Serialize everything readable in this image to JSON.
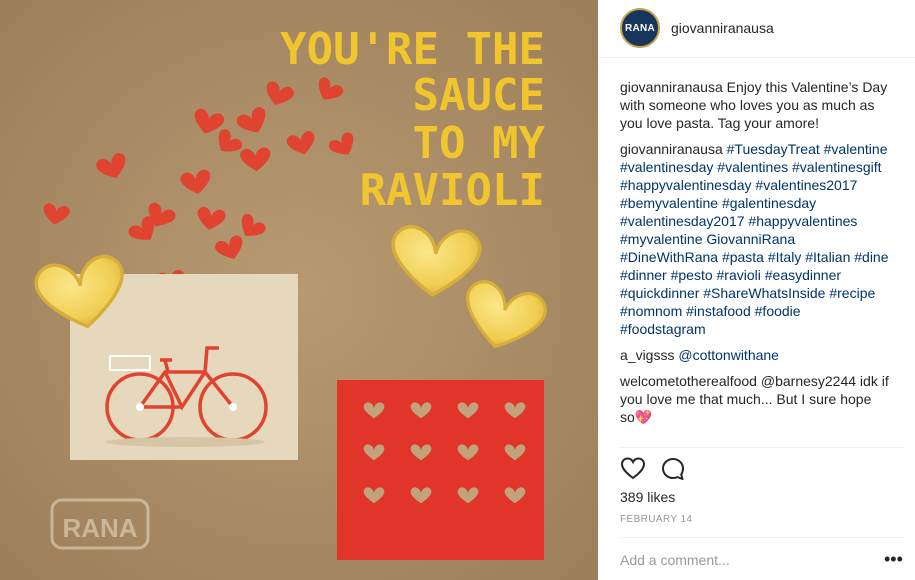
{
  "post": {
    "overlay_lines": [
      "YOU'RE THE",
      "SAUCE",
      "TO MY",
      "RAVIOLI"
    ],
    "watermark_text": "RANA",
    "colors": {
      "kraft": "#b4966e",
      "heart_red": "#e0432f",
      "card_red": "#e1352a",
      "ravioli": "#f1cf54",
      "text_yellow": "#f0c52e"
    }
  },
  "header": {
    "avatar_label": "RANA",
    "username": "giovanniranausa"
  },
  "comments": [
    {
      "user": "giovanniranausa",
      "text": "Enjoy this Valentine’s Day with someone who loves you as much as you love pasta. Tag your amore!",
      "removable": false
    },
    {
      "user": "giovanniranausa",
      "text": "#TuesdayTreat #valentine #valentinesday #valentines #valentinesgift #happyvalentinesday #valentines2017 #bemyvalentine #galentinesday #valentinesday2017 #happyvalentines #myvalentine GiovanniRana #DineWithRana #pasta #Italy #Italian #dine #dinner #pesto #ravioli #easydinner #quickdinner #ShareWhatsInside #recipe #nomnom #instafood #foodie #foodstagram",
      "removable": true
    },
    {
      "user": "a_vigsss",
      "text": "@cottonwithane",
      "removable": true
    },
    {
      "user": "welcometotherealfood",
      "text": "@barnesy2244 idk if you love me that much... But I sure hope so💖",
      "removable": true
    }
  ],
  "actions": {
    "like_icon": "heart-outline-icon",
    "comment_icon": "speech-bubble-icon"
  },
  "likes": "389 likes",
  "date": "FEBRUARY 14",
  "add_comment": {
    "placeholder": "Add a comment...",
    "more_label": "•••"
  }
}
